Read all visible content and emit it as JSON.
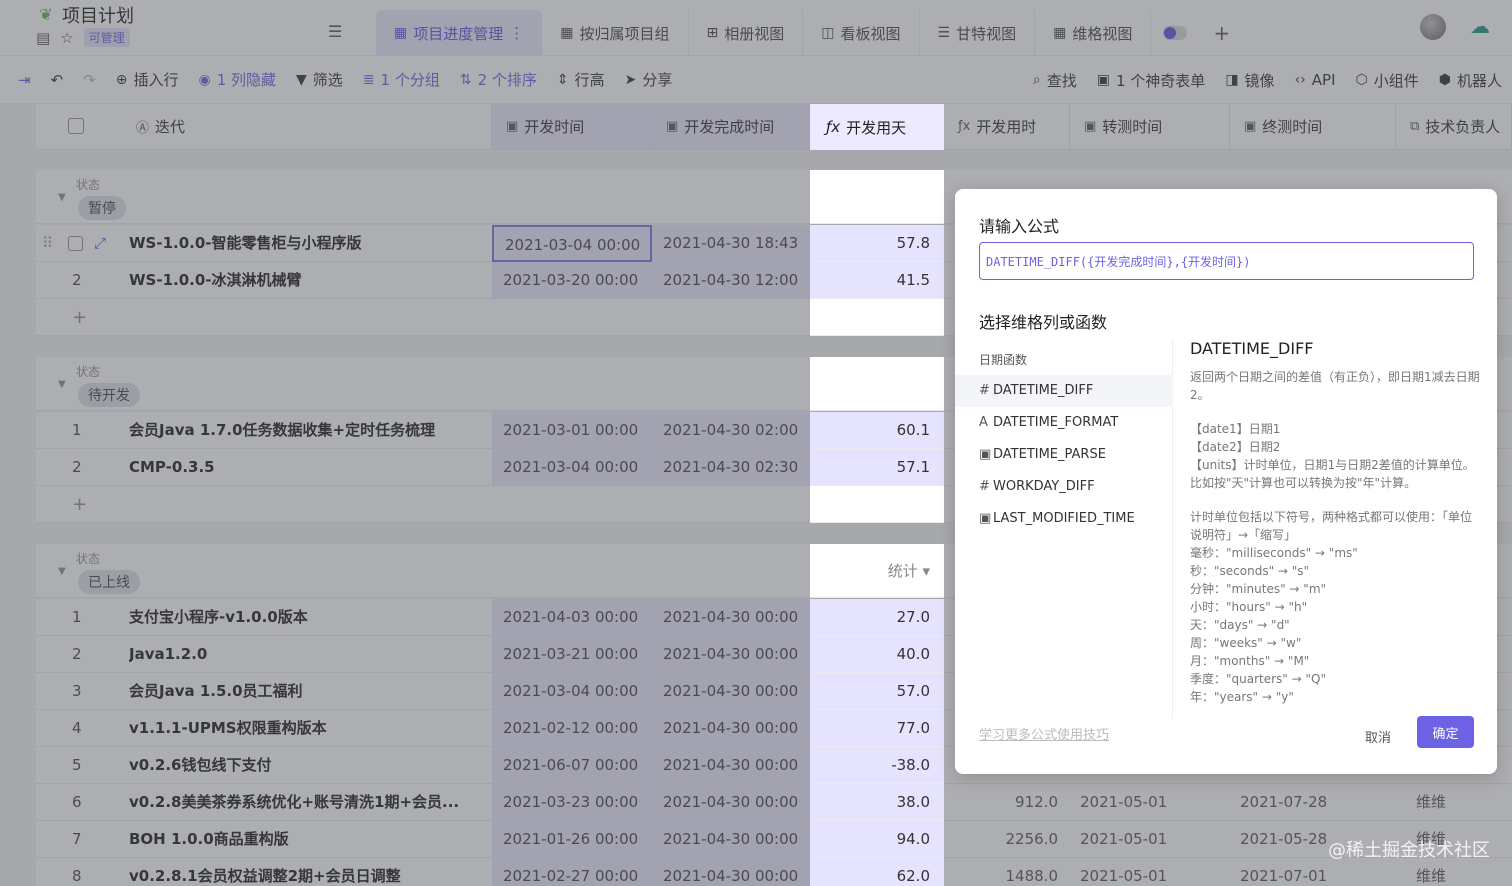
{
  "app": {
    "title": "项目计划",
    "badge": "可管理"
  },
  "views": [
    {
      "label": "项目进度管理",
      "active": true,
      "more": "⋮"
    },
    {
      "label": "按归属项目组"
    },
    {
      "label": "相册视图"
    },
    {
      "label": "看板视图"
    },
    {
      "label": "甘特视图"
    },
    {
      "label": "维格视图"
    }
  ],
  "toolbar": {
    "insert_row": "插入行",
    "hidden": "1 列隐藏",
    "filter": "筛选",
    "group": "1 个分组",
    "sort": "2 个排序",
    "row_height": "行高",
    "share": "分享",
    "search": "查找",
    "magic_form": "1 个神奇表单",
    "mirror": "镜像",
    "api": "API",
    "widget": "小组件",
    "robot": "机器人"
  },
  "columns": {
    "iteration": "迭代",
    "dev_start": "开发时间",
    "dev_end": "开发完成时间",
    "dev_days": "开发用天",
    "dev_hours": "开发用时",
    "test_start": "转测时间",
    "test_end": "终测时间",
    "owner": "技术负责人"
  },
  "groups": [
    {
      "label": "状态",
      "tag": "暂停",
      "rows": [
        {
          "num": "",
          "name": "WS-1.0.0-智能零售柜与小程序版",
          "start": "2021-03-04 00:00",
          "end": "2021-04-30 18:43",
          "days": "57.8"
        },
        {
          "num": "2",
          "name": "WS-1.0.0-冰淇淋机械臂",
          "start": "2021-03-20 00:00",
          "end": "2021-04-30 12:00",
          "days": "41.5"
        }
      ]
    },
    {
      "label": "状态",
      "tag": "待开发",
      "rows": [
        {
          "num": "1",
          "name": "会员Java 1.7.0任务数据收集+定时任务梳理",
          "start": "2021-03-01 00:00",
          "end": "2021-04-30 02:00",
          "days": "60.1"
        },
        {
          "num": "2",
          "name": "CMP-0.3.5",
          "start": "2021-03-04 00:00",
          "end": "2021-04-30 02:30",
          "days": "57.1"
        }
      ]
    },
    {
      "label": "状态",
      "tag": "已上线",
      "stat": "统计 ▾",
      "rows": [
        {
          "num": "1",
          "name": "支付宝小程序-v1.0.0版本",
          "start": "2021-04-03 00:00",
          "end": "2021-04-30 00:00",
          "days": "27.0"
        },
        {
          "num": "2",
          "name": "Java1.2.0",
          "start": "2021-03-21 00:00",
          "end": "2021-04-30 00:00",
          "days": "40.0"
        },
        {
          "num": "3",
          "name": "会员Java 1.5.0员工福利",
          "start": "2021-03-04 00:00",
          "end": "2021-04-30 00:00",
          "days": "57.0"
        },
        {
          "num": "4",
          "name": "v1.1.1-UPMS权限重构版本",
          "start": "2021-02-12 00:00",
          "end": "2021-04-30 00:00",
          "days": "77.0"
        },
        {
          "num": "5",
          "name": "v0.2.6钱包线下支付",
          "start": "2021-06-07 00:00",
          "end": "2021-04-30 00:00",
          "days": "-38.0"
        },
        {
          "num": "6",
          "name": "v0.2.8美美茶券系统优化+账号清洗1期+会员...",
          "start": "2021-03-23 00:00",
          "end": "2021-04-30 00:00",
          "days": "38.0",
          "hours": "912.0",
          "t1": "2021-05-01",
          "t2": "2021-07-28",
          "owner": "维维"
        },
        {
          "num": "7",
          "name": "BOH 1.0.0商品重构版",
          "start": "2021-01-26 00:00",
          "end": "2021-04-30 00:00",
          "days": "94.0",
          "hours": "2256.0",
          "t1": "2021-05-01",
          "t2": "2021-05-28",
          "owner": "维维"
        },
        {
          "num": "8",
          "name": "v0.2.8.1会员权益调整2期+会员日调整",
          "start": "2021-02-27 00:00",
          "end": "2021-04-30 00:00",
          "days": "62.0",
          "hours": "1488.0",
          "t1": "2021-05-01",
          "t2": "2021-07-01",
          "owner": "维维"
        }
      ]
    }
  ],
  "modal": {
    "title": "请输入公式",
    "formula": "DATETIME_DIFF({开发完成时间},{开发时间})",
    "section_title": "选择维格列或函数",
    "group_label": "日期函数",
    "functions": [
      {
        "icon": "#",
        "name": "DATETIME_DIFF",
        "selected": true
      },
      {
        "icon": "A",
        "name": "DATETIME_FORMAT"
      },
      {
        "icon": "▣",
        "name": "DATETIME_PARSE"
      },
      {
        "icon": "#",
        "name": "WORKDAY_DIFF"
      },
      {
        "icon": "▣",
        "name": "LAST_MODIFIED_TIME"
      }
    ],
    "doc": {
      "title": "DATETIME_DIFF",
      "desc": "返回两个日期之间的差值（有正负），即日期1减去日期2。",
      "params": [
        "【date1】日期1",
        "【date2】日期2",
        "【units】计时单位，日期1与日期2差值的计算单位。比如按\"天\"计算也可以转换为按\"年\"计算。"
      ],
      "units_intro": "计时单位包括以下符号，两种格式都可以使用：「单位说明符」→「缩写」",
      "units": [
        "毫秒：\"milliseconds\" → \"ms\"",
        "秒：\"seconds\" → \"s\"",
        "分钟：\"minutes\" → \"m\"",
        "小时：\"hours\" → \"h\"",
        "天：\"days\" → \"d\"",
        "周：\"weeks\" → \"w\"",
        "月：\"months\" → \"M\"",
        "季度：\"quarters\" → \"Q\"",
        "年：\"years\" → \"y\""
      ]
    },
    "learn_link": "学习更多公式使用技巧",
    "cancel": "取消",
    "confirm": "确定"
  },
  "watermark": "@稀土掘金技术社区"
}
